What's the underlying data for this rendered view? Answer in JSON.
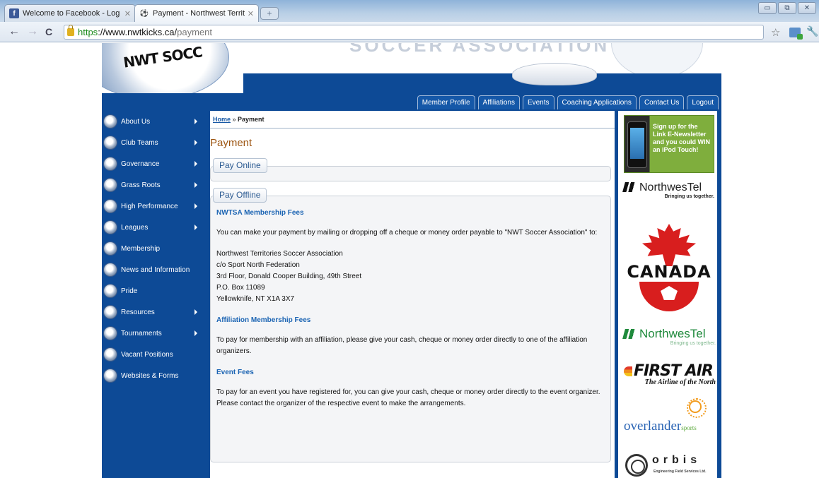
{
  "browser": {
    "tabs": [
      {
        "title": "Welcome to Facebook - Log In",
        "favicon": "facebook-icon"
      },
      {
        "title": "Payment - Northwest Territori",
        "favicon": "soccer-icon"
      }
    ],
    "url": {
      "scheme": "https",
      "host": "://www.nwtkicks.ca/",
      "path": "payment"
    },
    "window_buttons": {
      "minimize": "▭",
      "restore": "⧉",
      "close": "✕"
    },
    "nav": {
      "back": "←",
      "forward": "→",
      "reload": "C"
    }
  },
  "site": {
    "logo_text": "NWT SOCC",
    "banner_text": "SOCCER ASSOCIATION",
    "colors": {
      "nav_blue": "#0d4a96",
      "title_orange": "#9c5410",
      "link_blue": "#1658a5"
    }
  },
  "topnav": [
    "Member Profile",
    "Affiliations",
    "Events",
    "Coaching Applications",
    "Contact Us",
    "Logout"
  ],
  "sidebar": [
    {
      "label": "About Us",
      "has_submenu": true
    },
    {
      "label": "Club Teams",
      "has_submenu": true
    },
    {
      "label": "Governance",
      "has_submenu": true
    },
    {
      "label": "Grass Roots",
      "has_submenu": true
    },
    {
      "label": "High Performance",
      "has_submenu": true
    },
    {
      "label": "Leagues",
      "has_submenu": true
    },
    {
      "label": "Membership",
      "has_submenu": false
    },
    {
      "label": "News and Information",
      "has_submenu": false
    },
    {
      "label": "Pride",
      "has_submenu": false
    },
    {
      "label": "Resources",
      "has_submenu": true
    },
    {
      "label": "Tournaments",
      "has_submenu": true
    },
    {
      "label": "Vacant Positions",
      "has_submenu": false
    },
    {
      "label": "Websites & Forms",
      "has_submenu": false
    }
  ],
  "breadcrumb": {
    "home": "Home",
    "sep": " » ",
    "current": "Payment"
  },
  "page_title": "Payment",
  "pay_online": {
    "legend": "Pay Online"
  },
  "pay_offline": {
    "legend": "Pay Offline",
    "nwtsa_heading": "NWTSA Membership Fees",
    "nwtsa_text": "You can make your payment by mailing or dropping off a cheque or money order payable to \"NWT Soccer Association\" to:",
    "address": [
      "Northwest Territories Soccer Association",
      "c/o Sport North Federation",
      "3rd Floor, Donald Cooper Building, 49th Street",
      "P.O. Box 11089",
      "Yellowknife, NT X1A 3X7"
    ],
    "affiliation_heading": "Affiliation Membership Fees",
    "affiliation_text": "To pay for membership with an affiliation, please give your cash, cheque or money order directly to one of the affiliation organizers.",
    "event_heading": "Event Fees",
    "event_text": "To pay for an event you have registered for, you can give your cash, cheque or money order directly to the event organizer. Please contact the organizer of the respective event to make the arrangements."
  },
  "sponsors": {
    "ipod_ad": "Sign up for the Link E-Newsletter and you could WIN an iPod Touch!",
    "northwestel_1": {
      "name": "NorthwesTel",
      "tagline": "Bringing us together."
    },
    "canada": "CANADA",
    "northwestel_2": {
      "name": "NorthwesTel",
      "tagline": "Bringing us together."
    },
    "first_air": {
      "name": "FIRST AIR",
      "tagline": "The Airline of the North"
    },
    "overlander": {
      "name": "overlander",
      "suffix": "sports"
    },
    "orbis": {
      "name": "orbis",
      "tagline": "Engineering Field Services Ltd."
    }
  }
}
